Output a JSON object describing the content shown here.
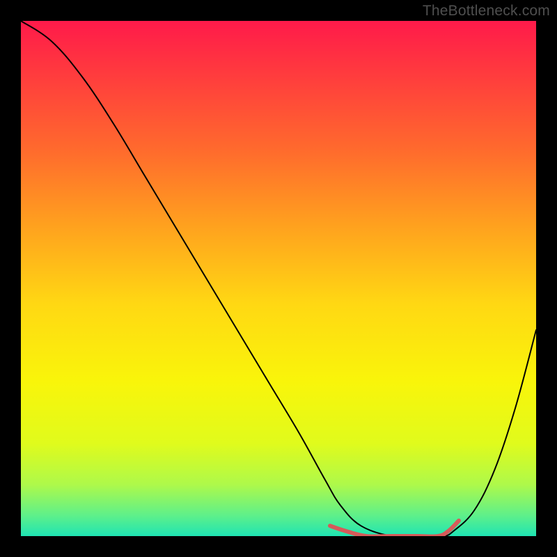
{
  "attribution": {
    "text": "TheBottleneck.com"
  },
  "axes_note": "No axis labels, tick labels, or title are visible in the image.",
  "chart_data": {
    "type": "line",
    "title": "",
    "xlabel": "",
    "ylabel": "",
    "xlim": [
      0,
      100
    ],
    "ylim": [
      0,
      100
    ],
    "legend": false,
    "grid": false,
    "background_gradient": {
      "stops": [
        {
          "offset": 0.0,
          "color": "#ff1a4a"
        },
        {
          "offset": 0.1,
          "color": "#ff3a3e"
        },
        {
          "offset": 0.25,
          "color": "#ff6a2d"
        },
        {
          "offset": 0.4,
          "color": "#ffa21e"
        },
        {
          "offset": 0.55,
          "color": "#ffd813"
        },
        {
          "offset": 0.7,
          "color": "#f9f50a"
        },
        {
          "offset": 0.82,
          "color": "#e0fb1c"
        },
        {
          "offset": 0.9,
          "color": "#aef94a"
        },
        {
          "offset": 0.96,
          "color": "#5ef08a"
        },
        {
          "offset": 1.0,
          "color": "#1fe4b3"
        }
      ]
    },
    "series": [
      {
        "name": "bottleneck-curve",
        "stroke": "#000000",
        "stroke_width": 2,
        "x": [
          0,
          6,
          12,
          18,
          24,
          30,
          36,
          42,
          48,
          54,
          59,
          62,
          66,
          72,
          78,
          82,
          84,
          88,
          92,
          96,
          100
        ],
        "y": [
          100,
          96,
          89,
          80,
          70,
          60,
          50,
          40,
          30,
          20,
          11,
          6,
          2,
          0,
          0,
          0,
          1,
          5,
          13,
          25,
          40
        ]
      },
      {
        "name": "optimum-band",
        "stroke": "#d65a5a",
        "stroke_width": 6,
        "x": [
          60,
          63,
          67,
          72,
          77,
          81,
          83,
          85
        ],
        "y": [
          2,
          1,
          0,
          0,
          0,
          0,
          1,
          3
        ]
      }
    ]
  }
}
